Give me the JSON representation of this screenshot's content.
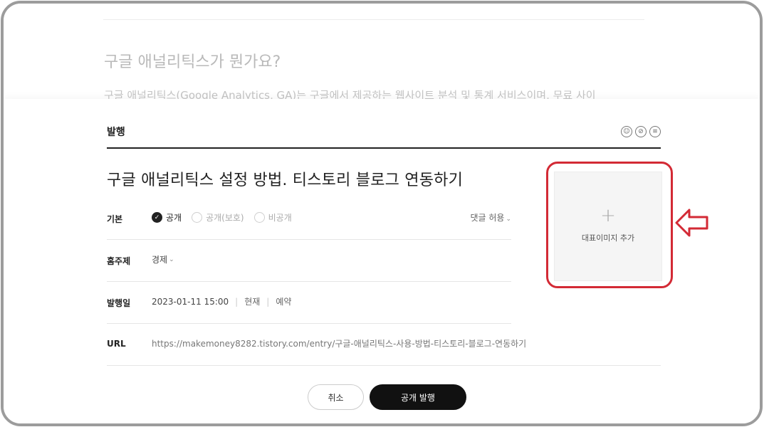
{
  "background_article": {
    "heading": "구글 애널리틱스가 뭔가요?",
    "paragraph": "구글 애널리틱스(Google Analytics, GA)는 구글에서 제공하는 웹사이트 분석 및 통계 서비스이며, 무료 사이"
  },
  "panel": {
    "title": "발행",
    "header_icons": [
      "accessibility-icon",
      "no-ads-icon",
      "menu-circle-icon"
    ],
    "post_title": "구글 애널리틱스 설정 방법. 티스토리 블로그 연동하기"
  },
  "visibility": {
    "label": "기본",
    "options": [
      {
        "label": "공개",
        "checked": true
      },
      {
        "label": "공개(보호)",
        "checked": false
      },
      {
        "label": "비공개",
        "checked": false
      }
    ],
    "comment_setting": "댓글 허용"
  },
  "category": {
    "label": "홈주제",
    "value": "경제"
  },
  "publish_date": {
    "label": "발행일",
    "datetime": "2023-01-11 15:00",
    "now_label": "현재",
    "schedule_label": "예약"
  },
  "url": {
    "label": "URL",
    "value": "https://makemoney8282.tistory.com/entry/구글-애널리틱스-사용-방법-티스토리-블로그-연동하기"
  },
  "thumbnail": {
    "plus": "+",
    "label": "대표이미지 추가"
  },
  "buttons": {
    "cancel": "취소",
    "publish": "공개 발행"
  },
  "colors": {
    "highlight": "#d32a35",
    "publish_button": "#111111"
  }
}
